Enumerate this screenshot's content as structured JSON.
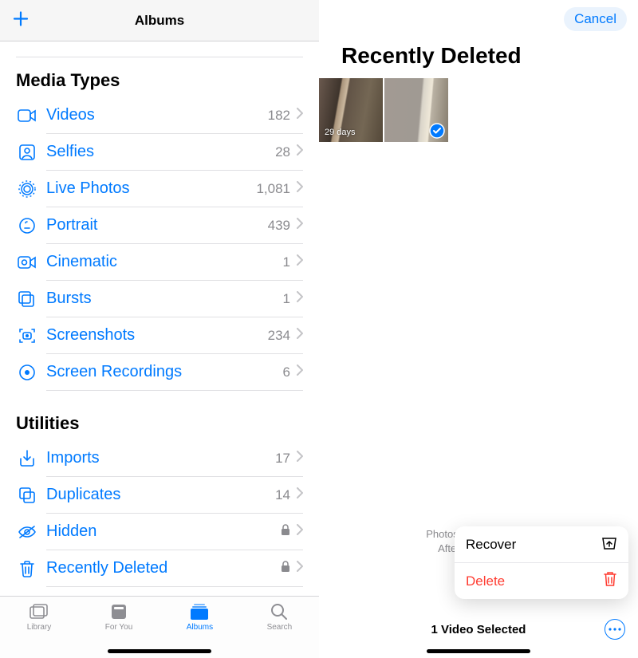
{
  "left": {
    "title": "Albums",
    "sections": {
      "media": {
        "heading": "Media Types",
        "items": [
          {
            "icon": "videos",
            "label": "Videos",
            "count": "182"
          },
          {
            "icon": "selfies",
            "label": "Selfies",
            "count": "28"
          },
          {
            "icon": "livephotos",
            "label": "Live Photos",
            "count": "1,081"
          },
          {
            "icon": "portrait",
            "label": "Portrait",
            "count": "439"
          },
          {
            "icon": "cinematic",
            "label": "Cinematic",
            "count": "1"
          },
          {
            "icon": "bursts",
            "label": "Bursts",
            "count": "1"
          },
          {
            "icon": "screenshots",
            "label": "Screenshots",
            "count": "234"
          },
          {
            "icon": "screenrec",
            "label": "Screen Recordings",
            "count": "6"
          }
        ]
      },
      "utilities": {
        "heading": "Utilities",
        "items": [
          {
            "icon": "imports",
            "label": "Imports",
            "count": "17"
          },
          {
            "icon": "duplicates",
            "label": "Duplicates",
            "count": "14"
          },
          {
            "icon": "hidden",
            "label": "Hidden",
            "locked": true
          },
          {
            "icon": "trash",
            "label": "Recently Deleted",
            "locked": true
          }
        ]
      }
    },
    "tabs": {
      "library": "Library",
      "foryou": "For You",
      "albums": "Albums",
      "search": "Search"
    }
  },
  "right": {
    "cancel": "Cancel",
    "title": "Recently Deleted",
    "thumbs": [
      {
        "days": "29 days",
        "selected": false
      },
      {
        "days": "",
        "selected": true
      }
    ],
    "footer_line1": "Photos and videos sho",
    "footer_line2": "After that time, ite",
    "sheet": {
      "recover": "Recover",
      "delete": "Delete"
    },
    "selection": "1 Video Selected"
  }
}
